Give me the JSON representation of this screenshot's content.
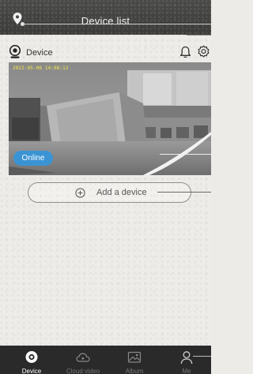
{
  "header": {
    "title": "Device list",
    "location_icon": "location-pin-icon"
  },
  "device": {
    "name": "Device",
    "timestamp": "2022-05-06 14:08:12",
    "status": "Online",
    "icons": [
      "camera-icon",
      "bell-icon",
      "gear-icon"
    ]
  },
  "add_device": {
    "label": "Add a device",
    "icon": "plus-circle-icon"
  },
  "tabs": [
    {
      "label": "Device",
      "icon": "device-tab-icon",
      "active": true
    },
    {
      "label": "Cloud video",
      "icon": "cloud-video-icon",
      "active": false
    },
    {
      "label": "Album",
      "icon": "album-icon",
      "active": false
    },
    {
      "label": "Me",
      "icon": "person-icon",
      "active": false
    }
  ],
  "colors": {
    "accent": "#3a94d4",
    "header_bg": "#3f3f3d",
    "tabbar_bg": "#2a2a2a",
    "timestamp": "#f4e94a"
  }
}
